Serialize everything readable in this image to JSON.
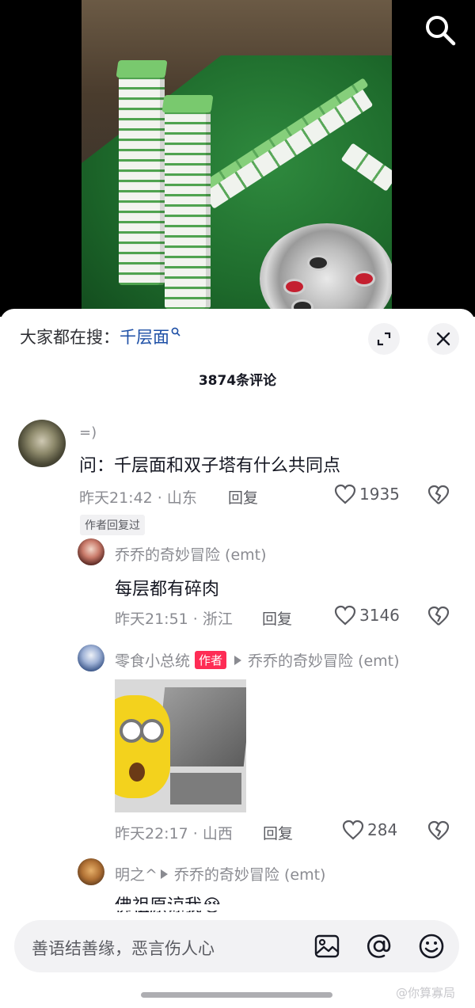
{
  "hot_search": {
    "prefix": "大家都在搜：",
    "keyword": "千层面"
  },
  "comment_count": "3874条评论",
  "comments": [
    {
      "user": "=)",
      "text": "问：千层面和双子塔有什么共同点",
      "time": "昨天21:42",
      "location": "山东",
      "reply_label": "回复",
      "likes": "1935",
      "tag": "作者回复过"
    },
    {
      "user": "乔乔的奇妙冒险 (emt)",
      "text": "每层都有碎肉",
      "time": "昨天21:51",
      "location": "浙江",
      "reply_label": "回复",
      "likes": "3146"
    },
    {
      "user": "零食小总统",
      "badge": "作者",
      "reply_to": "乔乔的奇妙冒险 (emt)",
      "time": "昨天22:17",
      "location": "山西",
      "reply_label": "回复",
      "likes": "284"
    },
    {
      "user": "明之^",
      "reply_to": "乔乔的奇妙冒险 (emt)",
      "text": "佛祖原谅我😭"
    }
  ],
  "input": {
    "placeholder": "善语结善缘，恶言伤人心"
  },
  "watermark": "@你算寡局",
  "colors": {
    "accent": "#fe2c55",
    "keyword": "#1d4fa6"
  }
}
